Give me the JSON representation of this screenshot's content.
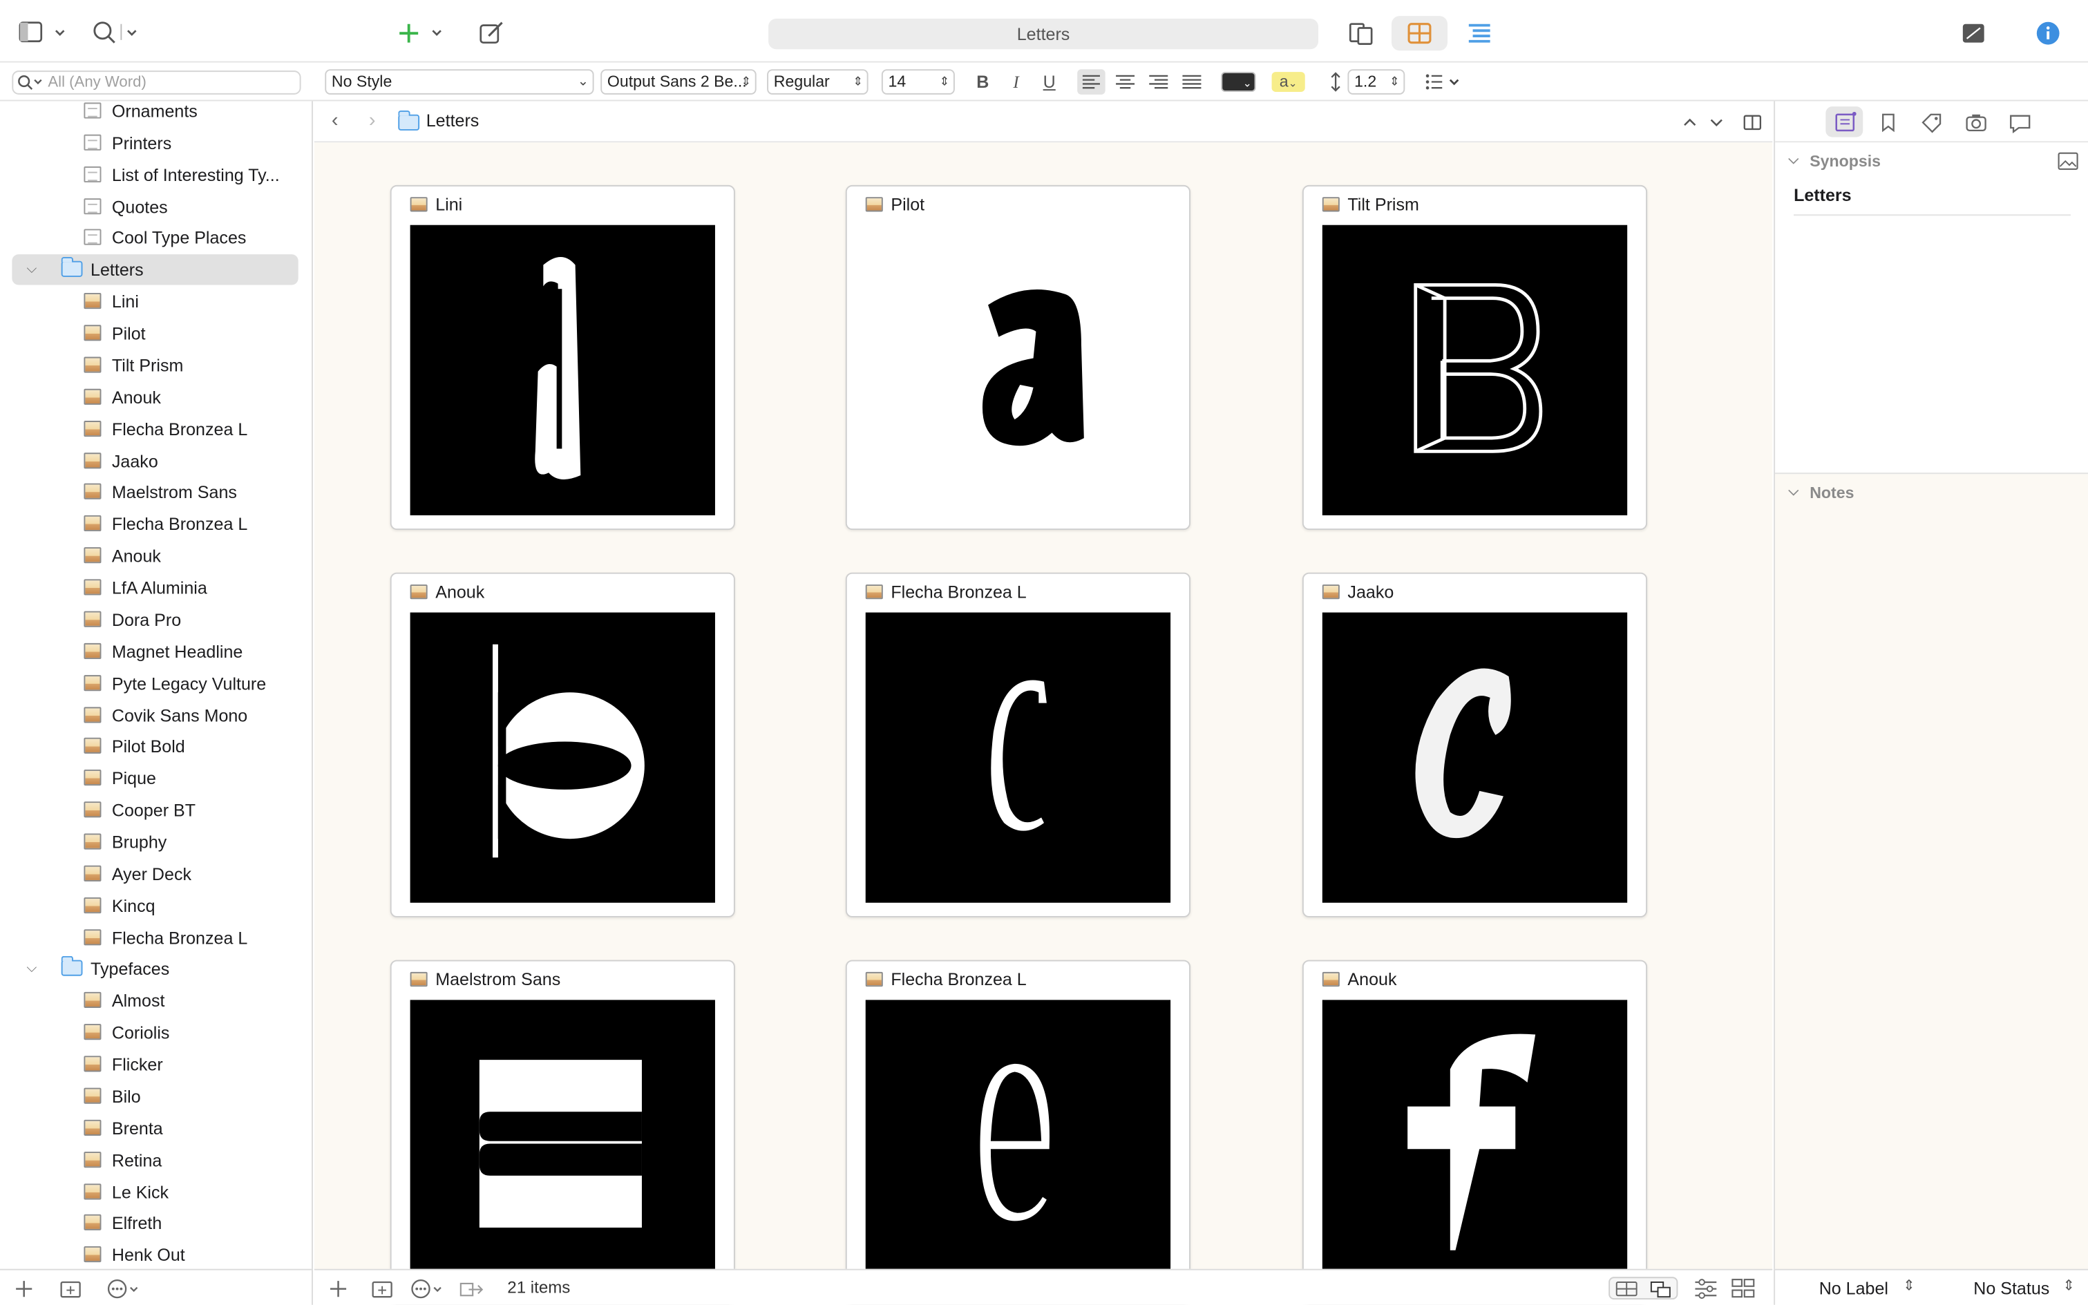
{
  "window": {
    "title": "Letters"
  },
  "toolbar": {
    "search_placeholder": "All (Any Word)"
  },
  "formatbar": {
    "style": "No Style",
    "font": "Output Sans 2 Be...",
    "weight": "Regular",
    "size": "14",
    "bold": "B",
    "italic": "I",
    "underline": "U",
    "highlight": "a",
    "line_spacing": "1.2"
  },
  "sidebar": {
    "research_items": [
      "Ornaments",
      "Printers",
      "List of Interesting Ty...",
      "Quotes",
      "Cool Type Places"
    ],
    "letters_folder": "Letters",
    "letters_items": [
      "Lini",
      "Pilot",
      "Tilt Prism",
      "Anouk",
      "Flecha Bronzea L",
      "Jaako",
      "Maelstrom Sans",
      "Flecha Bronzea L",
      "Anouk",
      "LfA Aluminia",
      "Dora Pro",
      "Magnet Headline",
      "Pyte Legacy Vulture",
      "Covik Sans Mono",
      "Pilot Bold",
      "Pique",
      "Cooper BT",
      "Bruphy",
      "Ayer Deck",
      "Kincq",
      "Flecha Bronzea L"
    ],
    "typefaces_folder": "Typefaces",
    "typefaces_items": [
      "Almost",
      "Coriolis",
      "Flicker",
      "Bilo",
      "Brenta",
      "Retina",
      "Le Kick",
      "Elfreth",
      "Henk Out"
    ]
  },
  "main": {
    "breadcrumb": "Letters",
    "cards": [
      {
        "title": "Lini",
        "glyph": "a",
        "style": "white-on-black"
      },
      {
        "title": "Pilot",
        "glyph": "a",
        "style": "black-on-white"
      },
      {
        "title": "Tilt Prism",
        "glyph": "B",
        "style": "white-on-black"
      },
      {
        "title": "Anouk",
        "glyph": "b",
        "style": "white-on-black"
      },
      {
        "title": "Flecha Bronzea L",
        "glyph": "c",
        "style": "white-on-black"
      },
      {
        "title": "Jaako",
        "glyph": "C",
        "style": "white-on-black"
      },
      {
        "title": "Maelstrom Sans",
        "glyph": "E",
        "style": "white-on-black"
      },
      {
        "title": "Flecha Bronzea L",
        "glyph": "e",
        "style": "white-on-black"
      },
      {
        "title": "Anouk",
        "glyph": "f",
        "style": "white-on-black"
      }
    ],
    "item_count": "21 items"
  },
  "inspector": {
    "synopsis_label": "Synopsis",
    "synopsis_title": "Letters",
    "notes_label": "Notes",
    "label_value": "No Label",
    "status_value": "No Status"
  },
  "colors": {
    "accent_blue": "#4f9fe6",
    "accent_orange": "#e0913a",
    "accent_green": "#3ab54a",
    "corkboard": "#fcf9f3"
  }
}
